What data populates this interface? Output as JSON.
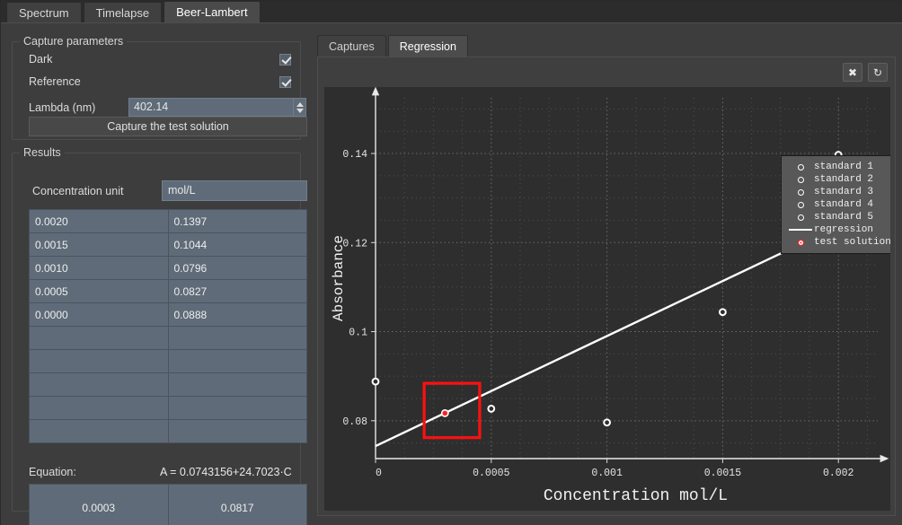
{
  "window": {
    "tabs": [
      {
        "label": "Spectrum",
        "active": false
      },
      {
        "label": "Timelapse",
        "active": false
      },
      {
        "label": "Beer-Lambert",
        "active": true
      }
    ]
  },
  "capture_parameters": {
    "title": "Capture parameters",
    "dark_label": "Dark",
    "dark_checked": true,
    "reference_label": "Reference",
    "reference_checked": true,
    "lambda_label": "Lambda (nm)",
    "lambda_value": "402.14",
    "capture_button": "Capture the test solution"
  },
  "results": {
    "title": "Results",
    "unit_label": "Concentration unit",
    "unit_value": "mol/L",
    "rows": [
      {
        "concentration": "0.0020",
        "absorbance": "0.1397"
      },
      {
        "concentration": "0.0015",
        "absorbance": "0.1044"
      },
      {
        "concentration": "0.0010",
        "absorbance": "0.0796"
      },
      {
        "concentration": "0.0005",
        "absorbance": "0.0827"
      },
      {
        "concentration": "0.0000",
        "absorbance": "0.0888"
      },
      {
        "concentration": "",
        "absorbance": ""
      },
      {
        "concentration": "",
        "absorbance": ""
      },
      {
        "concentration": "",
        "absorbance": ""
      },
      {
        "concentration": "",
        "absorbance": ""
      },
      {
        "concentration": "",
        "absorbance": ""
      }
    ],
    "equation_label": "Equation:",
    "equation_value": "A = 0.0743156+24.7023·C",
    "test_concentration": "0.0003",
    "test_absorbance": "0.0817"
  },
  "plot_panel": {
    "tabs": [
      {
        "label": "Captures",
        "active": false
      },
      {
        "label": "Regression",
        "active": true
      }
    ],
    "close_icon": "✖",
    "refresh_icon": "↻"
  },
  "chart_data": {
    "type": "scatter",
    "title": "",
    "xlabel": "Concentration mol/L",
    "ylabel": "Absorbance",
    "xlim": [
      0,
      0.00217
    ],
    "ylim": [
      0.0715,
      0.1525
    ],
    "xticks": [
      0,
      0.0005,
      0.001,
      0.0015,
      0.002
    ],
    "xticklabels": [
      "0",
      "0.0005",
      "0.001",
      "0.0015",
      "0.002"
    ],
    "yticks": [
      0.08,
      0.1,
      0.12,
      0.14
    ],
    "yticklabels": [
      "0.08",
      "0.1",
      "0.12",
      "0.14"
    ],
    "grid": true,
    "legend_position": "upper right",
    "series": [
      {
        "name": "standard 1",
        "marker": "ring",
        "color": "#ffffff",
        "points": [
          {
            "x": 0.002,
            "y": 0.1397
          }
        ]
      },
      {
        "name": "standard 2",
        "marker": "ring",
        "color": "#ffffff",
        "points": [
          {
            "x": 0.0015,
            "y": 0.1044
          }
        ]
      },
      {
        "name": "standard 3",
        "marker": "ring",
        "color": "#ffffff",
        "points": [
          {
            "x": 0.001,
            "y": 0.0796
          }
        ]
      },
      {
        "name": "standard 4",
        "marker": "ring",
        "color": "#ffffff",
        "points": [
          {
            "x": 0.0005,
            "y": 0.0827
          }
        ]
      },
      {
        "name": "standard 5",
        "marker": "ring",
        "color": "#ffffff",
        "points": [
          {
            "x": 0.0,
            "y": 0.0888
          }
        ]
      },
      {
        "name": "regression",
        "marker": "line",
        "color": "#ffffff",
        "line": {
          "intercept": 0.0743156,
          "slope": 24.7023
        }
      },
      {
        "name": "test solution",
        "marker": "ring",
        "color": "#ff2020",
        "points": [
          {
            "x": 0.0003,
            "y": 0.0817
          }
        ]
      }
    ],
    "highlight_box": {
      "x0": 0.00021,
      "x1": 0.00045,
      "y0": 0.0762,
      "y1": 0.0884,
      "color": "#ff1010"
    }
  }
}
